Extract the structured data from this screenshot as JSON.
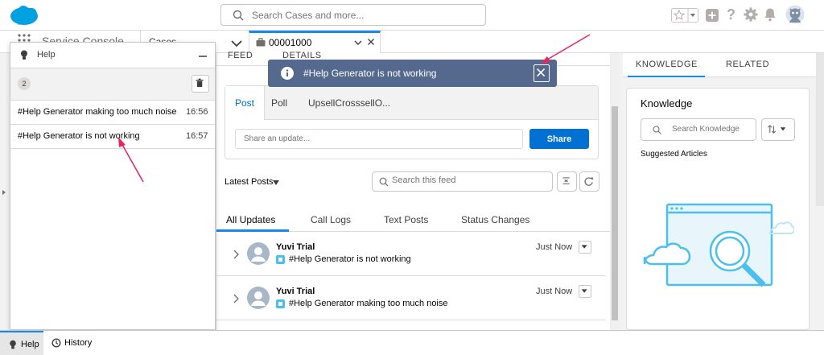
{
  "header": {
    "search_placeholder": "Search Cases and more..."
  },
  "nav": {
    "app_name": "Service Console",
    "object_tab": "Cases",
    "workspace_tab": "00001000"
  },
  "feed": {
    "top_tabs": [
      "FEED",
      "DETAILS"
    ],
    "publisher_tabs": [
      "Post",
      "Poll",
      "UpsellCrosssellO..."
    ],
    "share_placeholder": "Share an update...",
    "share_button": "Share",
    "sort_label": "Latest Posts",
    "search_placeholder": "Search this feed",
    "update_tabs": [
      "All Updates",
      "Call Logs",
      "Text Posts",
      "Status Changes"
    ],
    "posts": [
      {
        "author": "Yuvi Trial",
        "body": "#Help Generator is not working",
        "time": "Just Now"
      },
      {
        "author": "Yuvi Trial",
        "body": "#Help Generator making too much noise",
        "time": "Just Now"
      }
    ]
  },
  "knowledge": {
    "tabs": [
      "KNOWLEDGE",
      "RELATED"
    ],
    "title": "Knowledge",
    "search_placeholder": "Search Knowledge",
    "suggested_label": "Suggested Articles"
  },
  "help_panel": {
    "title": "Help",
    "count": "2",
    "items": [
      {
        "message": "#Help Generator making too much noise",
        "time": "16:56"
      },
      {
        "message": "#Help Generator is not working",
        "time": "16:57"
      }
    ]
  },
  "toast": {
    "message": "#Help Generator is not working"
  },
  "utility_bar": {
    "items": [
      "Help",
      "History"
    ]
  },
  "colors": {
    "brand_blue": "#0070d2",
    "tab_active": "#1589ee",
    "toast_bg": "#54698d",
    "annotation_arrow": "#e8265e",
    "illustration": "#4bc0ee"
  }
}
